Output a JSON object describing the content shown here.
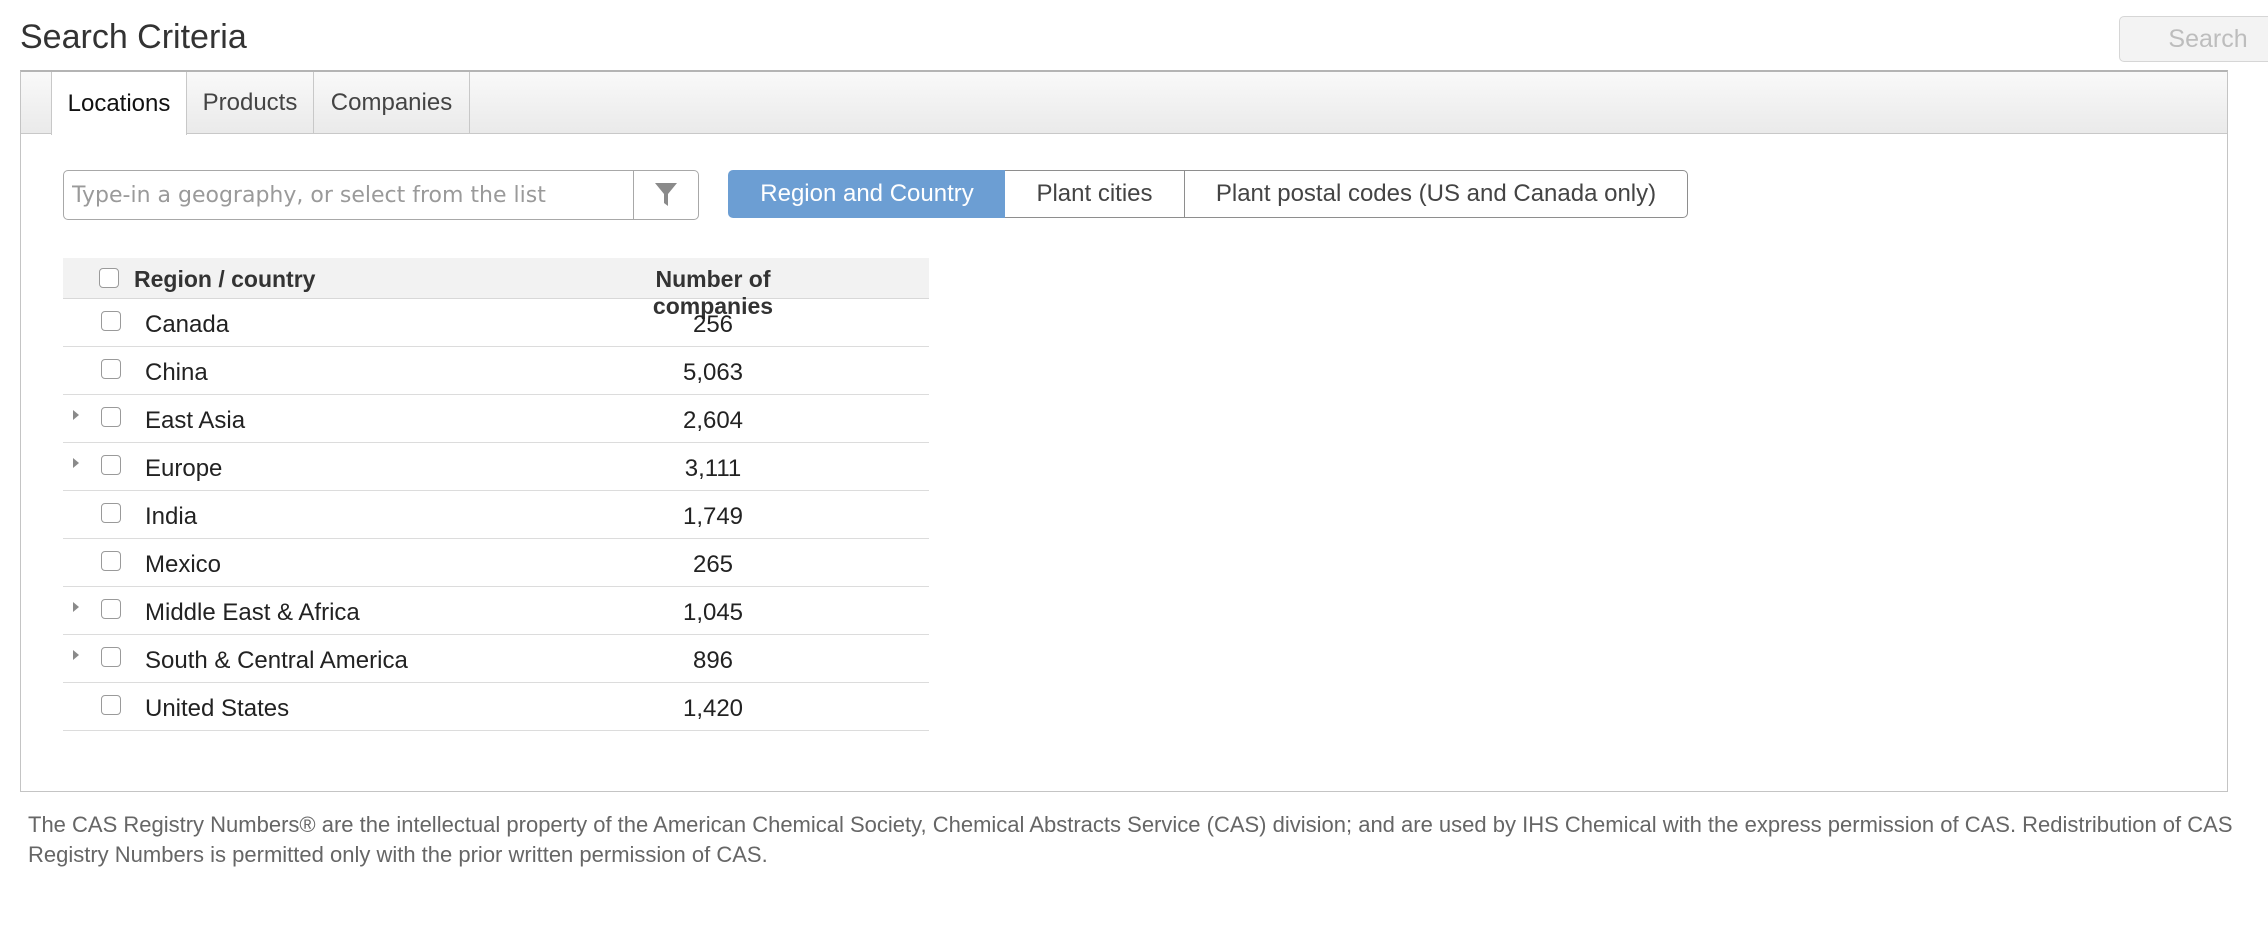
{
  "header": {
    "title": "Search Criteria",
    "search_label": "Search"
  },
  "tabs": [
    {
      "label": "Locations",
      "active": true
    },
    {
      "label": "Products",
      "active": false
    },
    {
      "label": "Companies",
      "active": false
    }
  ],
  "geo_search": {
    "placeholder": "Type-in a geography, or select from the list",
    "value": "",
    "filter_icon": "filter-icon"
  },
  "view_modes": [
    {
      "label": "Region and Country",
      "active": true
    },
    {
      "label": "Plant cities",
      "active": false
    },
    {
      "label": "Plant postal codes (US and Canada only)",
      "active": false
    }
  ],
  "table": {
    "columns": [
      "Region / country",
      "Number of companies"
    ],
    "rows": [
      {
        "name": "Canada",
        "count": "256",
        "expandable": false
      },
      {
        "name": "China",
        "count": "5,063",
        "expandable": false
      },
      {
        "name": "East Asia",
        "count": "2,604",
        "expandable": true
      },
      {
        "name": "Europe",
        "count": "3,111",
        "expandable": true
      },
      {
        "name": "India",
        "count": "1,749",
        "expandable": false
      },
      {
        "name": "Mexico",
        "count": "265",
        "expandable": false
      },
      {
        "name": "Middle East & Africa",
        "count": "1,045",
        "expandable": true
      },
      {
        "name": "South & Central America",
        "count": "896",
        "expandable": true
      },
      {
        "name": "United States",
        "count": "1,420",
        "expandable": false
      }
    ]
  },
  "footer": {
    "note": "The CAS Registry Numbers® are the intellectual property of the American Chemical Society, Chemical Abstracts Service (CAS) division; and are used by IHS Chemical with the express permission of CAS. Redistribution of CAS Registry Numbers is permitted only with the prior written permission of CAS."
  },
  "colors": {
    "accent": "#6c9ed3"
  }
}
